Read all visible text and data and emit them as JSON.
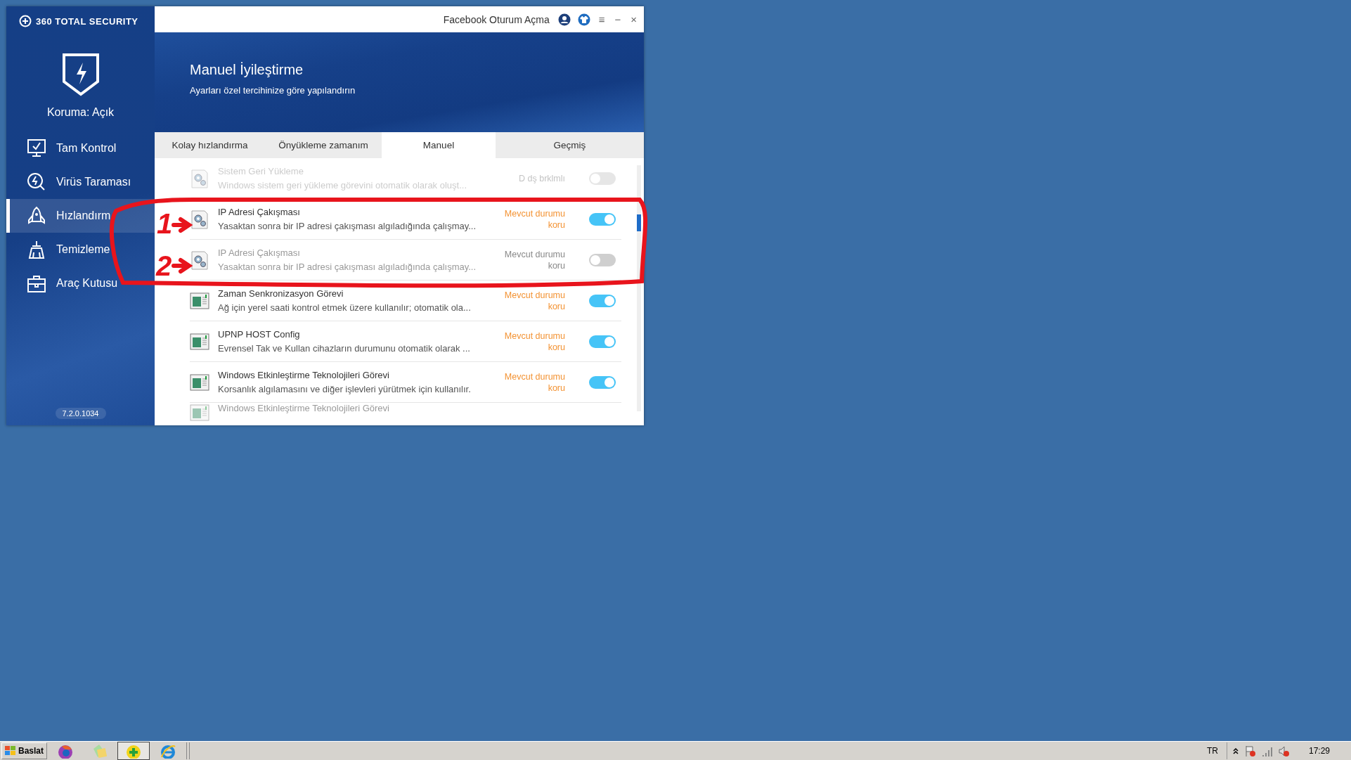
{
  "sidebar": {
    "brand": "360 TOTAL SECURITY",
    "protection": "Koruma: Açık",
    "items": [
      {
        "label": "Tam Kontrol",
        "kind": "monitor",
        "selected": false
      },
      {
        "label": "Virüs Taraması",
        "kind": "scan",
        "selected": false
      },
      {
        "label": "Hızlandırm",
        "kind": "rocket",
        "selected": true
      },
      {
        "label": "Temizleme",
        "kind": "broom",
        "selected": false
      },
      {
        "label": "Araç Kutusu",
        "kind": "toolbox",
        "selected": false
      }
    ],
    "version": "7.2.0.1034"
  },
  "title_bar": {
    "login": "Facebook Oturum Açma",
    "controls": [
      "≡",
      "−",
      "×"
    ]
  },
  "header": {
    "title": "Manuel İyileştirme",
    "subtitle": "Ayarları özel tercihinize göre yapılandırın"
  },
  "tabs": [
    {
      "label": "Kolay hızlandırma",
      "selected": false
    },
    {
      "label": "Önyükleme zamanım",
      "selected": false
    },
    {
      "label": "Manuel",
      "selected": true
    },
    {
      "label": "Geçmiş",
      "selected": false
    }
  ],
  "rows": [
    {
      "kind": "gear",
      "title": "Sistem Geri Yükleme",
      "description": "Windows sistem geri yükleme görevini otomatik olarak oluşt...",
      "status": "D dş brklmlı",
      "on": false,
      "faded": true
    },
    {
      "kind": "gear",
      "title": "IP Adresi Çakışması",
      "description": "Yasaktan sonra bir IP adresi çakışması algıladığında çalışmay...",
      "status": "Mevcut durumu koru",
      "on": true,
      "faded": false
    },
    {
      "kind": "gear",
      "title": "IP Adresi Çakışması",
      "description": "Yasaktan sonra bir IP adresi çakışması algıladığında çalışmay...",
      "status": "Mevcut durumu koru",
      "on": false,
      "faded": false
    },
    {
      "kind": "window",
      "title": "Zaman Senkronizasyon Görevi",
      "description": "Ağ için yerel saati kontrol etmek üzere kullanılır; otomatik ola...",
      "status": "Mevcut durumu koru",
      "on": true,
      "faded": false
    },
    {
      "kind": "window",
      "title": "UPNP HOST Config",
      "description": "Evrensel Tak ve Kullan cihazların durumunu otomatik olarak ...",
      "status": "Mevcut durumu koru",
      "on": true,
      "faded": false
    },
    {
      "kind": "window",
      "title": "Windows Etkinleştirme Teknolojileri Görevi",
      "description": "Korsanlık algılamasını ve diğer işlevleri yürütmek için kullanılır.",
      "status": "Mevcut durumu koru",
      "on": true,
      "faded": false
    },
    {
      "kind": "window",
      "title": "Windows Etkinleştirme Teknolojileri Görevi",
      "faded": true
    }
  ],
  "annotations": [
    {
      "label": "1"
    },
    {
      "label": "2"
    }
  ],
  "taskbar": {
    "start": "Baslat",
    "language": "TR",
    "clock": "17:29"
  }
}
